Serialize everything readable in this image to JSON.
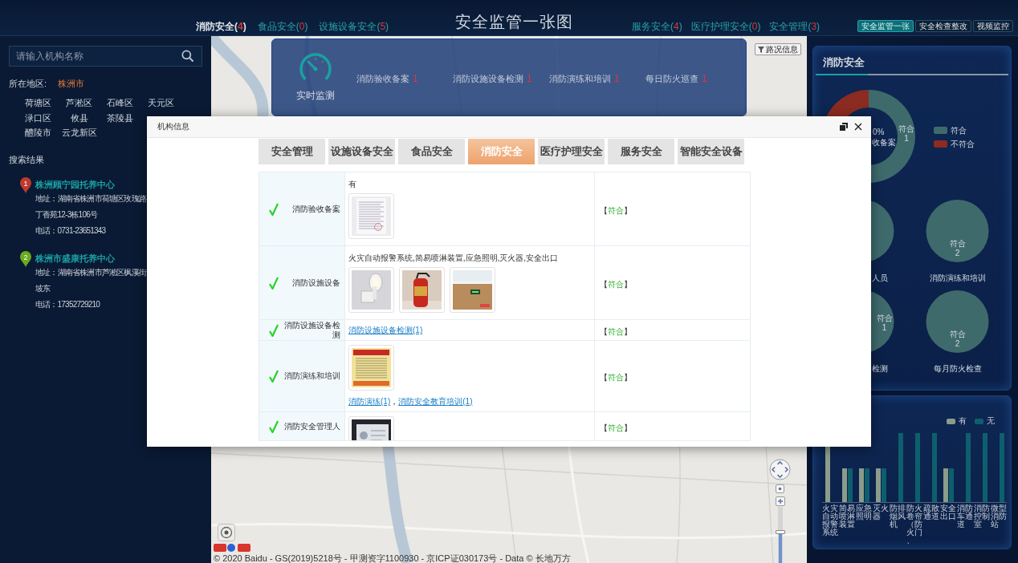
{
  "header": {
    "title": "安全监管一张图",
    "nav_left": [
      {
        "label": "消防安全",
        "count": "4",
        "brackets": [
          "(",
          ")"
        ],
        "selected": true
      },
      {
        "label": "食品安全",
        "count": "0",
        "brackets": [
          "(",
          ")"
        ],
        "selected": false
      },
      {
        "label": "设施设备安全",
        "count": "5",
        "brackets": [
          "(",
          ")"
        ],
        "selected": false
      }
    ],
    "nav_right": [
      {
        "label": "服务安全",
        "count": "4",
        "brackets": [
          "(",
          ")"
        ],
        "selected": false
      },
      {
        "label": "医疗护理安全",
        "count": "0",
        "brackets": [
          "(",
          ")"
        ],
        "selected": false
      },
      {
        "label": "安全管理",
        "count": "3",
        "brackets": [
          "(",
          ")"
        ],
        "selected": false
      }
    ],
    "view_tabs": [
      {
        "label": "安全监管一张",
        "selected": true
      },
      {
        "label": "安全检查整改",
        "selected": false
      },
      {
        "label": "视频监控",
        "selected": false
      }
    ]
  },
  "sidebar": {
    "search": {
      "placeholder": "请输入机构名称"
    },
    "region_label": "所在地区:",
    "region": "株洲市",
    "district_rows": [
      [
        "荷塘区",
        "芦淞区",
        "石峰区",
        "天元区"
      ],
      [
        "渌口区",
        "攸县",
        "茶陵县"
      ],
      [
        "醴陵市",
        "云龙新区"
      ]
    ],
    "results_title": "搜索结果",
    "search_results": [
      {
        "number": "1",
        "color": "#c0392b",
        "name": "株洲顾宁园托养中心",
        "address_lines": [
          "地址：湖南省株洲市荷塘区玫瑰路",
          "丁香苑12-3栋106号"
        ],
        "phone": "电话：0731-23651343"
      },
      {
        "number": "2",
        "color": "#6aab1f",
        "name": "株洲市盛康托养中心",
        "address_lines": [
          "地址：湖南省株洲市芦淞区枫溪街",
          "坡东"
        ],
        "phone": "电话：17352729210"
      }
    ]
  },
  "map": {
    "monitor": {
      "label": "实时监测",
      "items": [
        {
          "label": "消防验收备案",
          "count": "1"
        },
        {
          "label": "消防设施设备检测",
          "count": "1"
        },
        {
          "label": "消防演练和培训",
          "count": "1"
        },
        {
          "label": "每日防火巡查",
          "count": "1"
        }
      ]
    },
    "traffic_button": "路况信息",
    "zoom": {
      "level": 0.55
    },
    "attribution": "© 2020 Baidu - GS(2019)5218号 - 甲测资字1100930 - 京ICP证030173号 - Data © 长地万方"
  },
  "fire_safety_panel": {
    "title": "消防安全",
    "donut": {
      "center_text": [
        "0%",
        "收备案"
      ],
      "slices": [
        {
          "label": "符合",
          "value_label": "1",
          "color": "#3e6a6c"
        },
        {
          "color": "#8c2b22"
        }
      ]
    },
    "legend": [
      {
        "label": "符合",
        "color": "#3e6a6c"
      },
      {
        "label": "不符合",
        "color": "#8c2b22"
      }
    ],
    "pies": [
      {
        "caption": "人员",
        "slices": [
          {
            "color": "#3e6a6c"
          }
        ]
      },
      {
        "caption": "消防演练和培训",
        "slices": [
          {
            "label": "符合",
            "value_label": "2",
            "color": "#3e6a6c"
          }
        ]
      },
      {
        "caption": "检测",
        "slices": [
          {
            "label": "符合",
            "value_label": "1",
            "color": "#3e6a6c"
          }
        ]
      },
      {
        "caption": "每月防火检查",
        "slices": [
          {
            "label": "符合",
            "value_label": "2",
            "color": "#3e6a6c"
          }
        ]
      }
    ]
  },
  "equipment_chart": {
    "legend": [
      {
        "label": "有",
        "color": "#8a9c8a"
      },
      {
        "label": "无",
        "color": "#0d5f6d"
      }
    ],
    "categories": [
      "火灾自动报警系统",
      "简易喷淋装置",
      "应急照明",
      "灭火器",
      "防排烟风机",
      "防火卷帘（防火门、",
      "疏散通道",
      "安全出口",
      "消防车通道",
      "消防控制室",
      "微型消防站"
    ]
  },
  "dialog": {
    "title": "机构信息",
    "tabs": [
      {
        "label": "安全管理",
        "selected": false
      },
      {
        "label": "设施设备安全",
        "selected": false
      },
      {
        "label": "食品安全",
        "selected": false
      },
      {
        "label": "消防安全",
        "selected": true
      },
      {
        "label": "医疗护理安全",
        "selected": false
      },
      {
        "label": "服务安全",
        "selected": false
      },
      {
        "label": "智能安全设备",
        "selected": false
      }
    ],
    "rows": [
      {
        "label": "消防验收备案",
        "passed": true,
        "content": [
          {
            "kind": "text",
            "text": "有"
          },
          {
            "kind": "photos",
            "photos": [
              {
                "kind": "document"
              }
            ]
          }
        ],
        "result": [
          "【",
          "符合",
          "】"
        ]
      },
      {
        "label": "消防设施设备",
        "passed": true,
        "content": [
          {
            "kind": "text",
            "text": "火灾自动报警系统,简易喷淋装置,应急照明,灭火器,安全出口"
          },
          {
            "kind": "photos",
            "photos": [
              {
                "kind": "lamp"
              },
              {
                "kind": "extinguisher"
              },
              {
                "kind": "exit-sign"
              }
            ]
          }
        ],
        "result": [
          "【",
          "符合",
          "】"
        ]
      },
      {
        "label": "消防设施设备检测",
        "passed": true,
        "content": [
          {
            "kind": "links",
            "items": [
              {
                "kind": "link",
                "text": "消防设施设备检测(1)"
              }
            ]
          }
        ],
        "result": [
          "【",
          "符合",
          "】"
        ]
      },
      {
        "label": "消防演练和培训",
        "passed": true,
        "content": [
          {
            "kind": "photos",
            "photos": [
              {
                "kind": "poster"
              }
            ]
          },
          {
            "kind": "links",
            "items": [
              {
                "kind": "link",
                "text": "消防演练(1)"
              },
              {
                "kind": "text",
                "text": "，"
              },
              {
                "kind": "link",
                "text": "消防安全教育培训(1)"
              }
            ]
          }
        ],
        "result": [
          "【",
          "符合",
          "】"
        ]
      },
      {
        "label": "消防安全管理人",
        "passed": true,
        "content": [
          {
            "kind": "photos",
            "photos": [
              {
                "kind": "id-card"
              }
            ]
          }
        ],
        "result": [
          "【",
          "符合",
          "】"
        ]
      }
    ]
  }
}
